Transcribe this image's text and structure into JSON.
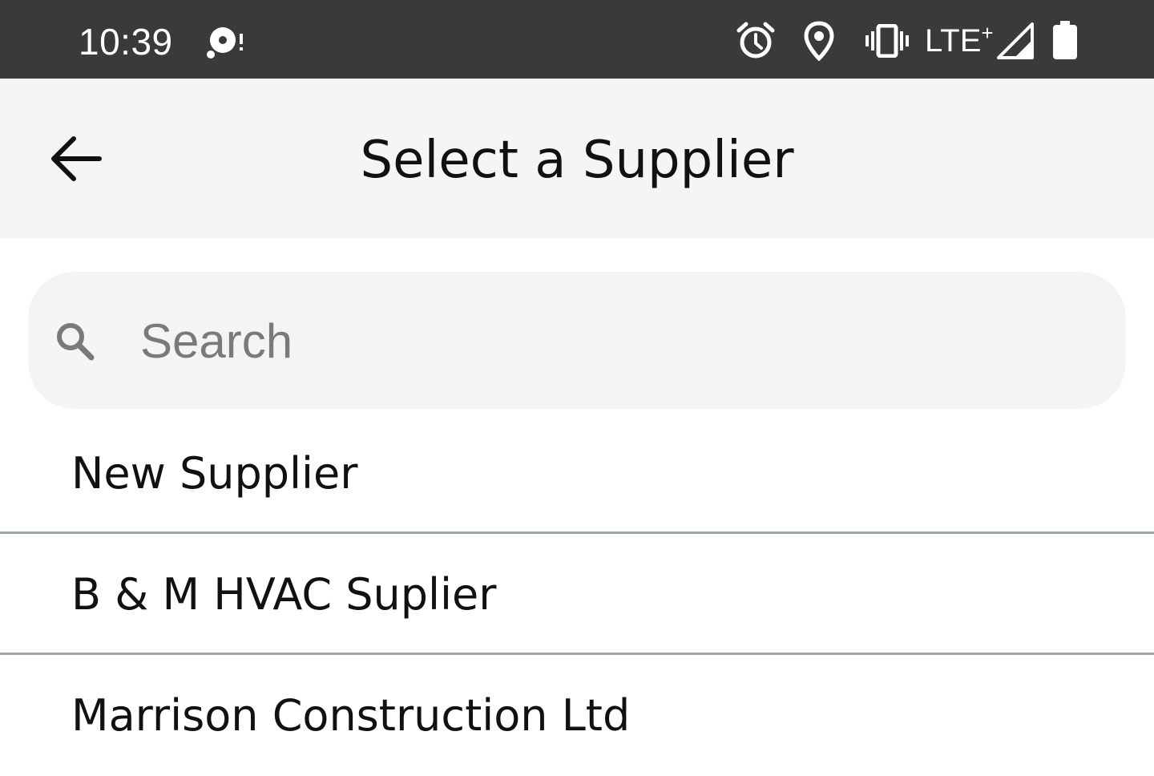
{
  "status_bar": {
    "time": "10:39",
    "network": "LTE",
    "network_suffix": "+",
    "icons": [
      "app-notification-icon",
      "alarm-icon",
      "location-icon",
      "vibrate-icon",
      "signal-icon",
      "battery-icon"
    ]
  },
  "app_bar": {
    "title": "Select a Supplier",
    "back_icon": "arrow-back-icon"
  },
  "search": {
    "placeholder": "Search",
    "value": "",
    "icon": "search-icon"
  },
  "suppliers": [
    {
      "label": "New Supplier"
    },
    {
      "label": "B & M HVAC Suplier"
    },
    {
      "label": "Marrison Construction Ltd"
    }
  ],
  "colors": {
    "status_bar_bg": "#3a3a3a",
    "app_bar_bg": "#f5f5f5",
    "search_bg": "#f4f4f4",
    "divider": "#9aa6ae",
    "text_primary": "#111111",
    "placeholder": "#7a7a7a"
  }
}
